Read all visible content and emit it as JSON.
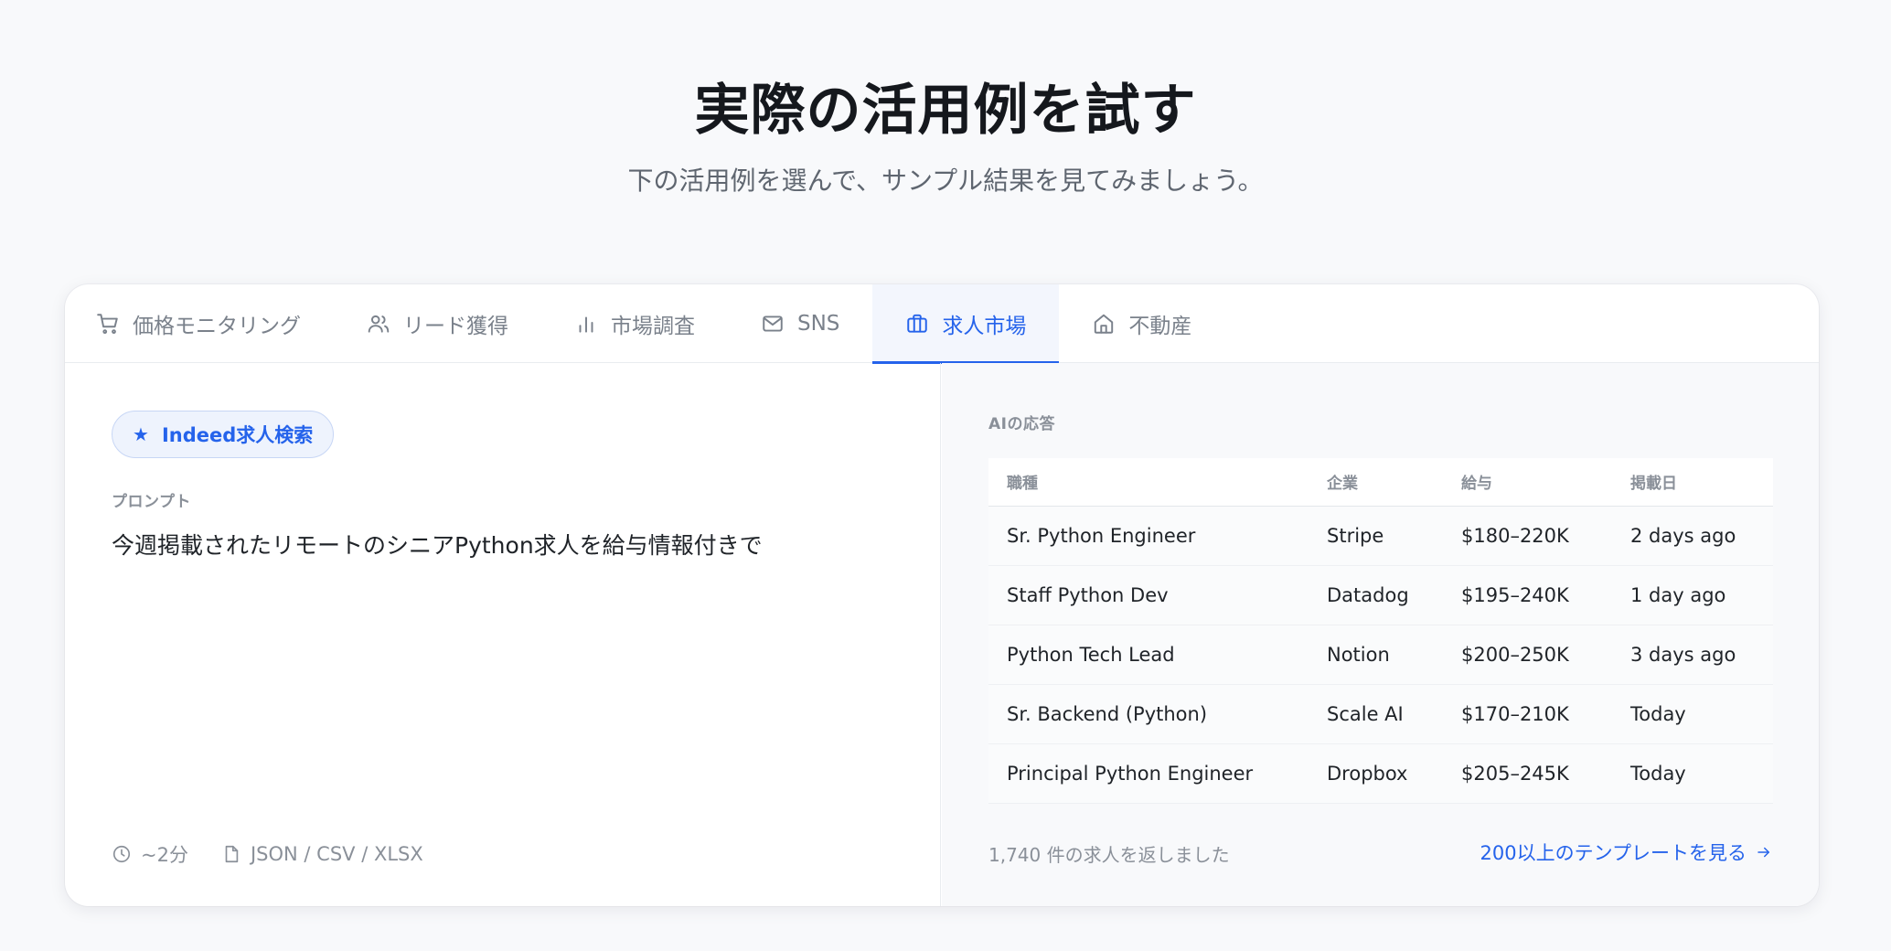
{
  "hero": {
    "title": "実際の活用例を試す",
    "subtitle": "下の活用例を選んで、サンプル結果を見てみましょう。"
  },
  "tabs": [
    {
      "label": "価格モニタリング",
      "icon": "cart-icon",
      "active": false
    },
    {
      "label": "リード獲得",
      "icon": "users-icon",
      "active": false
    },
    {
      "label": "市場調査",
      "icon": "bar-chart-icon",
      "active": false
    },
    {
      "label": "SNS",
      "icon": "mail-icon",
      "active": false
    },
    {
      "label": "求人市場",
      "icon": "briefcase-icon",
      "active": true
    },
    {
      "label": "不動産",
      "icon": "home-icon",
      "active": false
    }
  ],
  "example": {
    "pill_label": "Indeed求人検索",
    "prompt_label": "プロンプト",
    "prompt_text": "今週掲載されたリモートのシニアPython求人を給与情報付きで",
    "duration": "~2分",
    "formats": "JSON / CSV / XLSX"
  },
  "response": {
    "label": "AIの応答",
    "columns": [
      "職種",
      "企業",
      "給与",
      "掲載日"
    ],
    "rows": [
      [
        "Sr. Python Engineer",
        "Stripe",
        "$180–220K",
        "2 days ago"
      ],
      [
        "Staff Python Dev",
        "Datadog",
        "$195–240K",
        "1 day ago"
      ],
      [
        "Python Tech Lead",
        "Notion",
        "$200–250K",
        "3 days ago"
      ],
      [
        "Sr. Backend (Python)",
        "Scale AI",
        "$170–210K",
        "Today"
      ],
      [
        "Principal Python Engineer",
        "Dropbox",
        "$205–245K",
        "Today"
      ]
    ],
    "count_text": "1,740 件の求人を返しました",
    "templates_link": "200以上のテンプレートを見る"
  },
  "colors": {
    "accent": "#2563eb",
    "background": "#f8f9fb"
  }
}
